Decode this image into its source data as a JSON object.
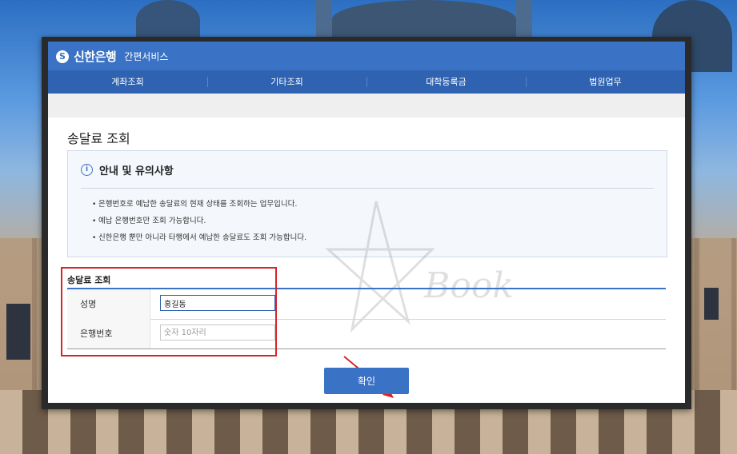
{
  "header": {
    "brand": "신한은행",
    "service": "간편서비스",
    "logo_glyph": "S"
  },
  "nav": {
    "items": [
      "계좌조회",
      "기타조회",
      "대학등록금",
      "법원업무"
    ]
  },
  "page": {
    "title": "송달료 조회"
  },
  "notice": {
    "title": "안내 및 유의사항",
    "icon": "info-icon",
    "items": [
      "은행번호로 예납한 송달료의 현재 상태를 조회하는 업무입니다.",
      "예납 은행번호만 조회 가능합니다.",
      "신한은행 뿐만 아니라 타행에서 예납한 송달료도 조회 가능합니다."
    ]
  },
  "form": {
    "title": "송달료 조회",
    "name_label": "성명",
    "name_value": "홍길동",
    "bank_label": "은행번호",
    "bank_placeholder": "숫자 10자리",
    "bank_value": ""
  },
  "actions": {
    "confirm_label": "확인"
  },
  "watermark": {
    "text": "Book"
  },
  "colors": {
    "brand_blue": "#3a72c6",
    "nav_blue": "#2f62b0",
    "highlight_red": "#d7232a"
  }
}
